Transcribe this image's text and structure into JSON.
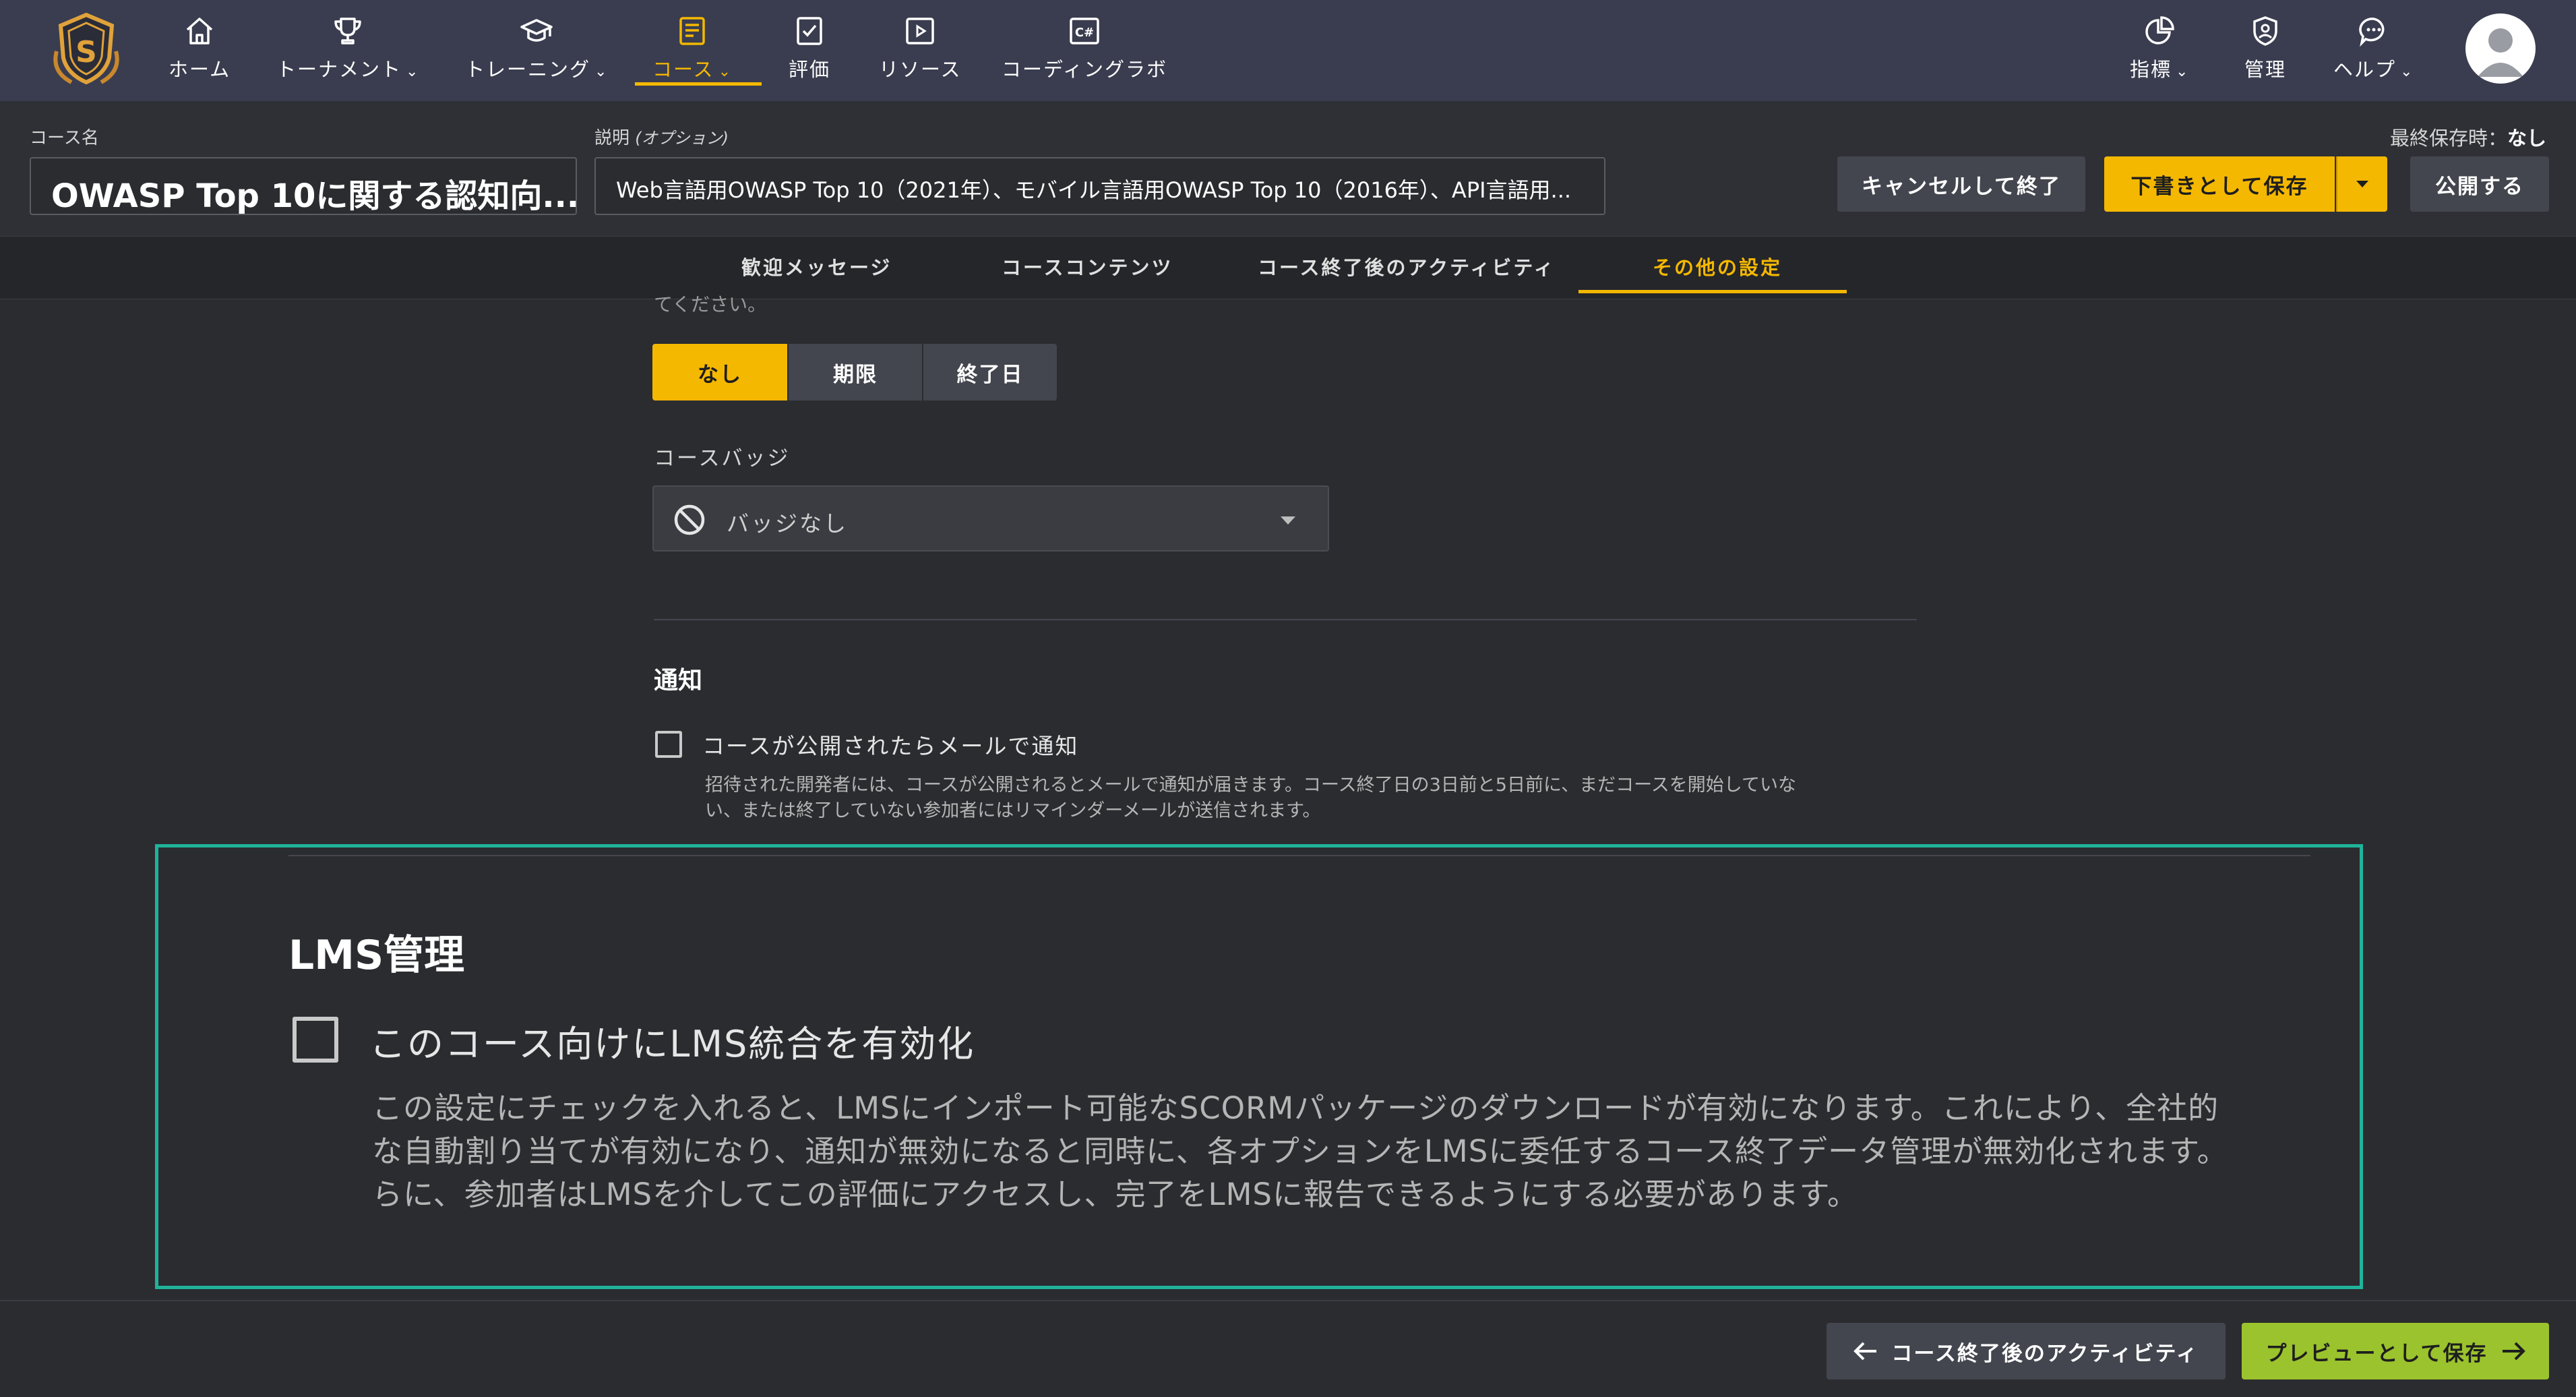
{
  "nav": {
    "items": [
      {
        "label": "ホーム",
        "icon": "home-icon"
      },
      {
        "label": "トーナメント",
        "icon": "trophy-icon",
        "caret": "⌄"
      },
      {
        "label": "トレーニング",
        "icon": "graduation-cap-icon",
        "caret": "⌄"
      },
      {
        "label": "コース",
        "icon": "course-list-icon",
        "caret": "⌄",
        "active": true
      },
      {
        "label": "評価",
        "icon": "assessment-icon"
      },
      {
        "label": "リソース",
        "icon": "video-resource-icon"
      },
      {
        "label": "コーディングラボ",
        "icon": "code-lab-icon"
      }
    ],
    "right": [
      {
        "label": "指標",
        "icon": "pie-chart-icon",
        "caret": "⌄"
      },
      {
        "label": "管理",
        "icon": "admin-badge-icon"
      },
      {
        "label": "ヘルプ",
        "icon": "chat-help-icon",
        "caret": "⌄"
      }
    ]
  },
  "header": {
    "course_name_label": "コース名",
    "course_name_value": "OWASP Top 10に関する認知向...",
    "description_label": "説明",
    "description_optional": "(オプション)",
    "description_value": "Web言語用OWASP Top 10（2021年）、モバイル言語用OWASP Top 10（2016年）、API言語用...",
    "last_saved_label": "最終保存時：",
    "last_saved_value": "なし",
    "cancel_button": "キャンセルして終了",
    "save_draft_button": "下書きとして保存",
    "publish_button": "公開する"
  },
  "tabs": [
    {
      "label": "歓迎メッセージ"
    },
    {
      "label": "コースコンテンツ"
    },
    {
      "label": "コース終了後のアクティビティ"
    },
    {
      "label": "その他の設定",
      "active": true
    }
  ],
  "content": {
    "cut_text": "てください。",
    "deadline_options": [
      "なし",
      "期限",
      "終了日"
    ],
    "deadline_selected": "なし",
    "badge_label": "コースバッジ",
    "badge_value": "バッジなし",
    "notify_title": "通知",
    "notify_checkbox": "コースが公開されたらメールで通知",
    "notify_checked": false,
    "notify_help_1": "招待された開発者には、コースが公開されるとメールで通知が届きます。コース終了日の3日前と5日前に、まだコースを開始していな",
    "notify_help_2": "い、または終了していない参加者にはリマインダーメールが送信されます。",
    "lms_title": "LMS管理",
    "lms_checkbox": "このコース向けにLMS統合を有効化",
    "lms_checked": false,
    "lms_help_1": "この設定にチェックを入れると、LMSにインポート可能なSCORMパッケージのダウンロードが有効になります。これにより、全社的",
    "lms_help_2": "な自動割り当てが有効になり、通知が無効になると同時に、各オプションをLMSに委任するコース終了データ管理が無効化されます。",
    "lms_help_3": "らに、参加者はLMSを介してこの評価にアクセスし、完了をLMSに報告できるようにする必要があります。"
  },
  "footer": {
    "back_button": "コース終了後のアクティビティ",
    "preview_button": "プレビューとして保存"
  },
  "colors": {
    "accent": "#f5b800",
    "highlight": "#1fb39a",
    "preview": "#9bc32d",
    "nav_bg": "#3a3d4f"
  }
}
